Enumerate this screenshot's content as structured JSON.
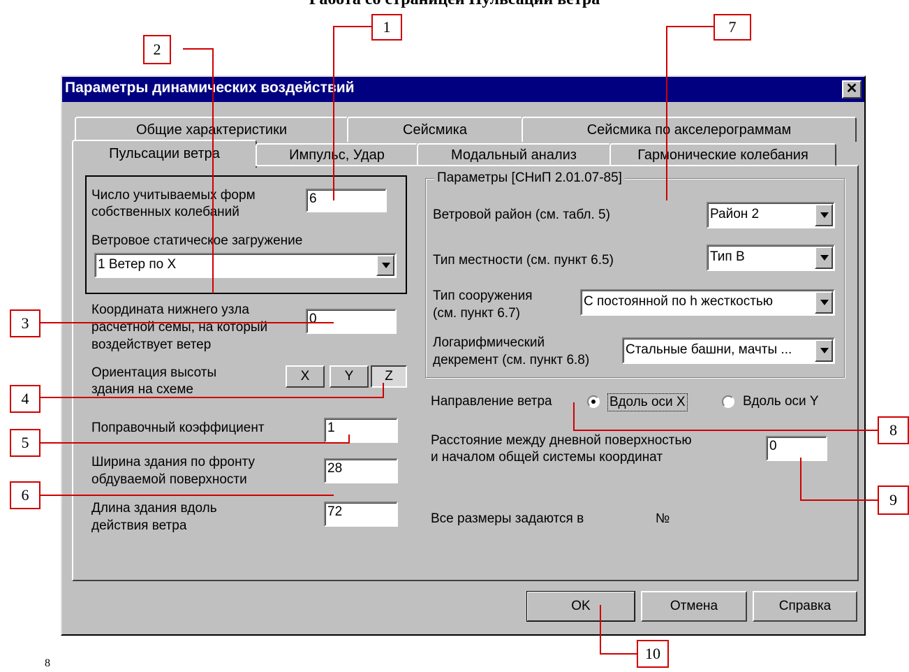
{
  "page_heading": "Работа со страницей Пульсации ветра",
  "window": {
    "title": "Параметры динамических воздействий",
    "close": "✕"
  },
  "tabs_back": [
    "Общие характеристики",
    "Сейсмика",
    "Сейсмика по акселерограммам"
  ],
  "tabs_front": [
    "Пульсации ветра",
    "Импульс, Удар",
    "Модальный анализ",
    "Гармонические колебания"
  ],
  "left": {
    "forms_label_1": "Число учитываемых форм",
    "forms_label_2": "собственных колебаний",
    "forms_value": "6",
    "static_load_label": "Ветровое статическое загружение",
    "static_load_value": "1  Ветер по X",
    "coord_label_1": "Координата нижнего узла",
    "coord_label_2": "расчетной семы, на который",
    "coord_label_3": "воздействует ветер",
    "coord_value": "0",
    "orient_label_1": "Ориентация высоты",
    "orient_label_2": "здания на схеме",
    "axis_x": "X",
    "axis_y": "Y",
    "axis_z": "Z",
    "corr_label": "Поправочный коэффициент",
    "corr_value": "1",
    "width_label_1": "Ширина здания по фронту",
    "width_label_2": "обдуваемой поверхности",
    "width_value": "28",
    "length_label_1": "Длина здания вдоль",
    "length_label_2": "действия ветра",
    "length_value": "72"
  },
  "right": {
    "group_title": "Параметры [СНиП 2.01.07-85]",
    "region_label": "Ветровой район (см. табл. 5)",
    "region_value": "Район 2",
    "terrain_label": "Тип местности (см. пункт 6.5)",
    "terrain_value": "Тип B",
    "structure_label_1": "Тип сооружения",
    "structure_label_2": "(см. пункт 6.7)",
    "structure_value": "С постоянной по h жесткостью",
    "decrement_label_1": "Логарифмический",
    "decrement_label_2": "декремент (см. пункт 6.8)",
    "decrement_value": "Стальные башни, мачты ...",
    "direction_label": "Направление ветра",
    "dir_x": "Вдоль оси X",
    "dir_y": "Вдоль оси Y",
    "dir_selected": "x",
    "distance_label_1": "Расстояние между дневной поверхностью",
    "distance_label_2": "и началом общей системы координат",
    "distance_value": "0",
    "units_label": "Все размеры задаются в",
    "units_value": "№"
  },
  "buttons": {
    "ok": "OK",
    "cancel": "Отмена",
    "help": "Справка"
  },
  "callouts": [
    "1",
    "2",
    "3",
    "4",
    "5",
    "6",
    "7",
    "8",
    "9",
    "10"
  ],
  "footer_mark": "8",
  "colors": {
    "title_bar": "#000080",
    "dialog_face": "#c0c0c0",
    "callout_line": "#d00000"
  }
}
